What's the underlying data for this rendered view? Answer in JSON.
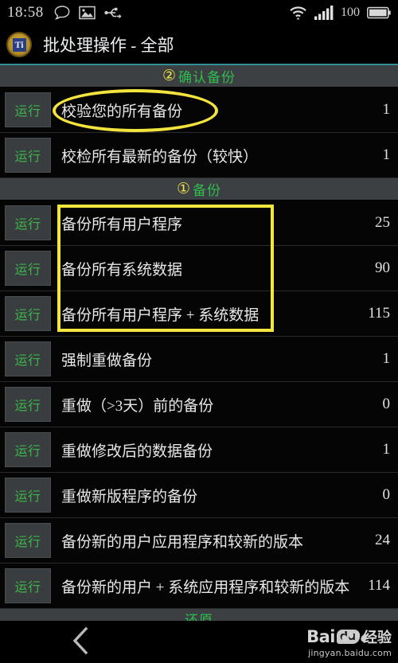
{
  "status_bar": {
    "time": "18:58",
    "left_icons": [
      "message-bubble-icon",
      "gallery-image-icon",
      "usb-icon"
    ],
    "wifi_icon": "wifi-icon",
    "signal_icon": "cellular-signal-icon",
    "battery_level": "100",
    "battery_icon": "battery-full-icon"
  },
  "title_bar": {
    "app_icon": "titanium-backup-icon",
    "app_icon_mark": "Ti",
    "title": "批处理操作 - 全部"
  },
  "sections": [
    {
      "annotation_number": "②",
      "label": "确认备份",
      "rows": [
        {
          "button": "运行",
          "label": "校验您的所有备份",
          "count": "1",
          "highlight": "ellipse"
        },
        {
          "button": "运行",
          "label": "校检所有最新的备份（较快）",
          "count": "1",
          "highlight": "none"
        }
      ]
    },
    {
      "annotation_number": "①",
      "label": "备份",
      "rows": [
        {
          "button": "运行",
          "label": "备份所有用户程序",
          "count": "25",
          "highlight": "rect"
        },
        {
          "button": "运行",
          "label": "备份所有系统数据",
          "count": "90",
          "highlight": "rect"
        },
        {
          "button": "运行",
          "label": "备份所有用户程序 + 系统数据",
          "count": "115",
          "highlight": "rect"
        },
        {
          "button": "运行",
          "label": "强制重做备份",
          "count": "1",
          "highlight": "none"
        },
        {
          "button": "运行",
          "label": "重做（>3天）前的备份",
          "count": "0",
          "highlight": "none"
        },
        {
          "button": "运行",
          "label": "重做修改后的数据备份",
          "count": "1",
          "highlight": "none"
        },
        {
          "button": "运行",
          "label": "重做新版程序的备份",
          "count": "0",
          "highlight": "none"
        },
        {
          "button": "运行",
          "label": "备份新的用户应用程序和较新的版本",
          "count": "24",
          "highlight": "none"
        },
        {
          "button": "运行",
          "label": "备份新的用户 + 系统应用程序和较新的版本",
          "count": "114",
          "highlight": "none"
        }
      ]
    },
    {
      "annotation_number": "",
      "label": "还原",
      "rows": []
    }
  ],
  "nav_bar": {
    "back_icon": "back-chevron-icon"
  },
  "watermark": {
    "brand": "Bai",
    "badge": "du",
    "suffix": "经验",
    "url": "jingyan.baidu.com",
    "paw_icon": "baidu-paw-icon"
  },
  "colors": {
    "accent_green": "#2fbd4e",
    "run_green": "#3cb54a",
    "annotation_yellow": "#f2e33f",
    "section_bg": "#3c4043",
    "teal_rule": "#2e8f96"
  }
}
